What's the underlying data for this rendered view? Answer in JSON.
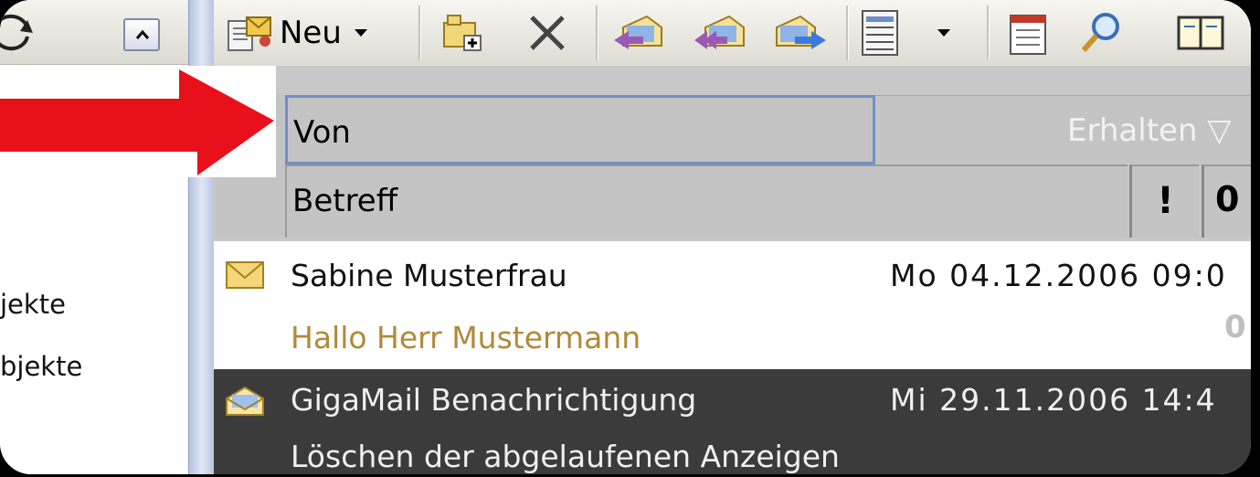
{
  "sidebar": {
    "items": [
      {
        "label": "jekte"
      },
      {
        "label": "bjekte"
      }
    ]
  },
  "toolbar": {
    "new_label": "Neu"
  },
  "columns": {
    "from": "Von",
    "received": "Erhalten",
    "subject": "Betreff",
    "importance": "!",
    "attachment": "0"
  },
  "messages": [
    {
      "from": "Sabine Musterfrau",
      "date": "Mo 04.12.2006 09:0",
      "subject": "Hallo Herr Mustermann",
      "icon": "envelope-closed-icon",
      "has_attachment": true,
      "selected": false
    },
    {
      "from": "GigaMail Benachrichtigung",
      "date": "Mi 29.11.2006 14:4",
      "subject": "Löschen der abgelaufenen Anzeigen",
      "icon": "envelope-open-icon",
      "has_attachment": false,
      "selected": true
    }
  ],
  "colors": {
    "annotation_arrow": "#e8101a",
    "column_header": "#c4c4c4",
    "active_header_border": "#6f8fc7",
    "selected_row": "#3b3b3b",
    "unread_subject": "#b08a3a"
  }
}
